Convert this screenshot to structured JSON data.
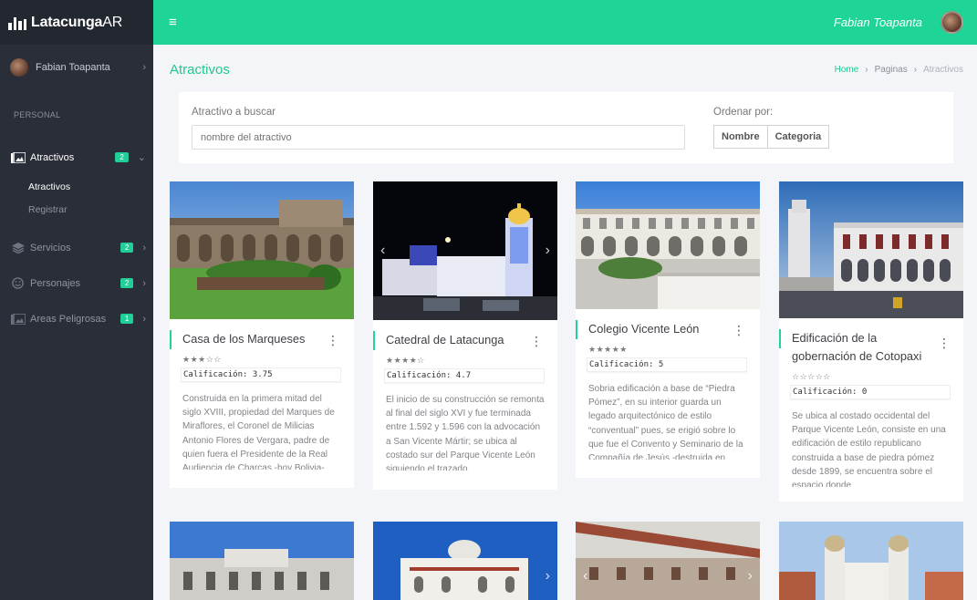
{
  "app": {
    "brand_bold": "Latacunga",
    "brand_light": "AR"
  },
  "sidebar": {
    "user_name": "Fabian Toapanta",
    "section": "PERSONAL",
    "items": [
      {
        "label": "Atractivos",
        "badge": "2",
        "icon": "image-gallery-icon"
      },
      {
        "label": "Servicios",
        "badge": "2",
        "icon": "layers-icon"
      },
      {
        "label": "Personajes",
        "badge": "2",
        "icon": "smiley-icon"
      },
      {
        "label": "Areas Peligrosas",
        "badge": "1",
        "icon": "image-gallery-icon"
      }
    ],
    "sub_items": [
      "Atractivos",
      "Registrar"
    ]
  },
  "header": {
    "user_name": "Fabian Toapanta"
  },
  "page": {
    "title": "Atractivos",
    "breadcrumb": [
      "Home",
      "Paginas",
      "Atractivos"
    ]
  },
  "search": {
    "label": "Atractivo a buscar",
    "placeholder": "nombre del atractivo",
    "order_label": "Ordenar por:",
    "order_options": [
      "Nombre",
      "Categoria"
    ]
  },
  "cards": [
    {
      "title": "Casa de los Marqueses",
      "stars": "★★★☆☆",
      "rating": "Calificación: 3.75",
      "description": "Construida en la primera mitad del siglo XVIII, propiedad del Marques de Miraflores, el Coronel de Milicias Antonio Flores de Vergara, padre de quien fuera el Presidente de la Real Audiencia de Charcas -hoy Bolivia-"
    },
    {
      "title": "Catedral de Latacunga",
      "stars": "★★★★☆",
      "rating": "Calificación: 4.7",
      "description": "El inicio de su construcción se remonta al final del siglo XVI y fue terminada entre 1.592 y 1.596 con la advocación a San Vicente Mártir; se ubica al costado sur del Parque Vicente León siguiendo el trazado"
    },
    {
      "title": "Colegio Vicente León",
      "stars": "★★★★★",
      "rating": "Calificación: 5",
      "description": "Sobria edificación a base de “Piedra Pómez”, en su interior guarda un legado arquitectónico de estilo “conventual” pues, se erigió sobre lo que fue el Convento y Seminario de la Compañía de Jesús -destruida en"
    },
    {
      "title": "Edificación de la gobernación de Cotopaxi",
      "stars": "☆☆☆☆☆",
      "rating": "Calificación: 0",
      "description": "Se ubica al costado occidental del Parque Vicente León, consiste en una edificación de estilo republicano construida a base de piedra pómez desde 1899, se encuentra sobre el espacio donde"
    }
  ]
}
